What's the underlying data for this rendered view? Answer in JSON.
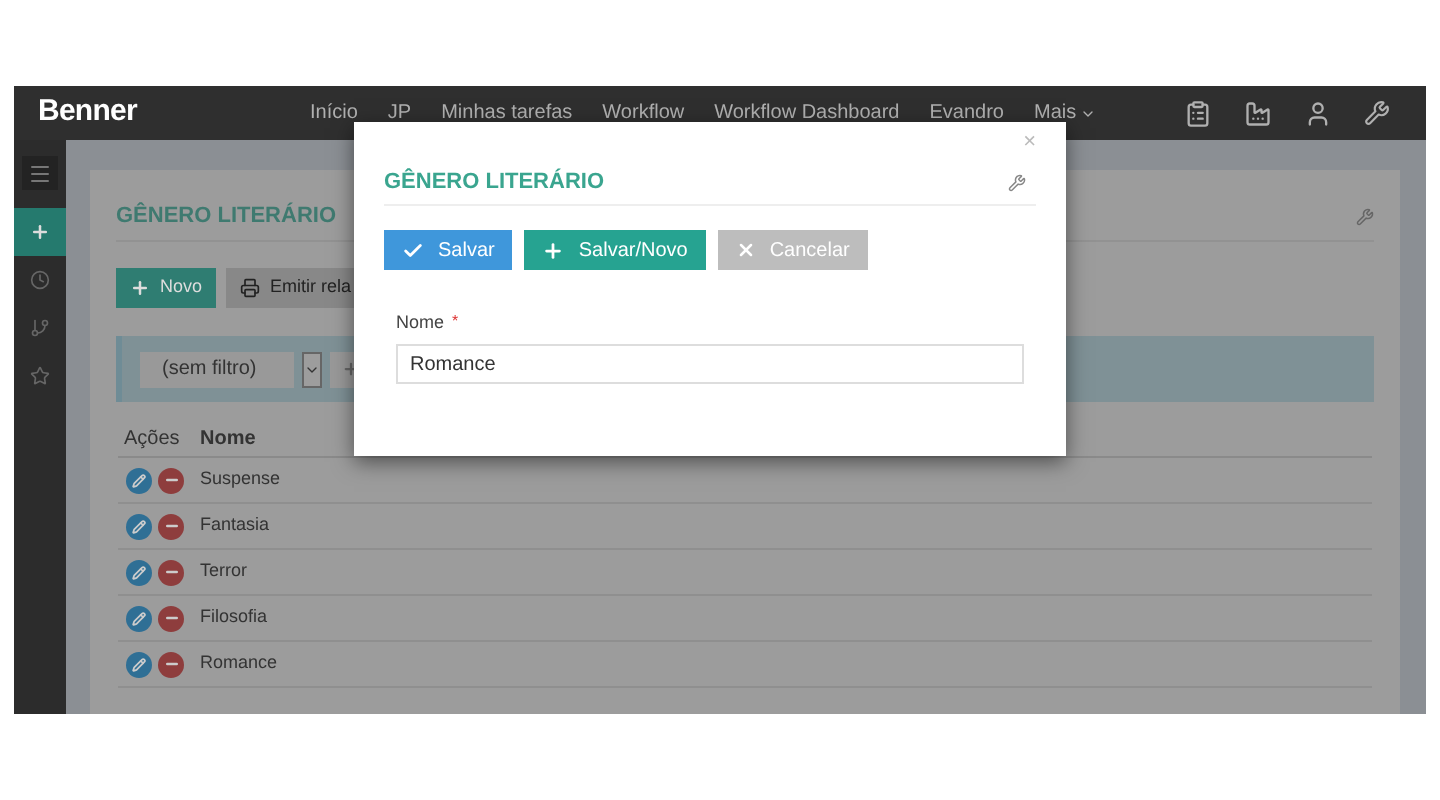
{
  "top_bar": {
    "logo": "Benner",
    "nav": [
      {
        "label": "Início",
        "kind": "link"
      },
      {
        "label": "JP",
        "kind": "link"
      },
      {
        "label": "Minhas tarefas",
        "kind": "link"
      },
      {
        "label": "Workflow",
        "kind": "link"
      },
      {
        "label": "Workflow Dashboard",
        "kind": "link"
      },
      {
        "label": "Evandro",
        "kind": "link"
      },
      {
        "label": "Mais",
        "kind": "dropdown"
      }
    ]
  },
  "sidebar": {
    "items": [
      {
        "selected": true
      },
      {
        "selected": false
      },
      {
        "selected": false
      },
      {
        "selected": false
      }
    ]
  },
  "page": {
    "title": "GÊNERO LITERÁRIO",
    "actions": [
      {
        "label": "Novo",
        "kind": "add"
      },
      {
        "label": "Emitir rela",
        "kind": "print"
      }
    ],
    "filter": {
      "value": "(sem filtro)"
    },
    "table": {
      "columns": [
        "Ações",
        "Nome"
      ],
      "rows": [
        {
          "nome": "Suspense"
        },
        {
          "nome": "Fantasia"
        },
        {
          "nome": "Terror"
        },
        {
          "nome": "Filosofia"
        },
        {
          "nome": "Romance"
        }
      ]
    }
  },
  "modal": {
    "title": "GÊNERO LITERÁRIO",
    "close": "×",
    "buttons": [
      {
        "label": "Salvar",
        "kind": "save"
      },
      {
        "label": "Salvar/Novo",
        "kind": "add"
      },
      {
        "label": "Cancelar",
        "kind": "cancel"
      }
    ],
    "field": {
      "label": "Nome",
      "required": true,
      "required_mark": "*",
      "value": "Romance"
    }
  }
}
